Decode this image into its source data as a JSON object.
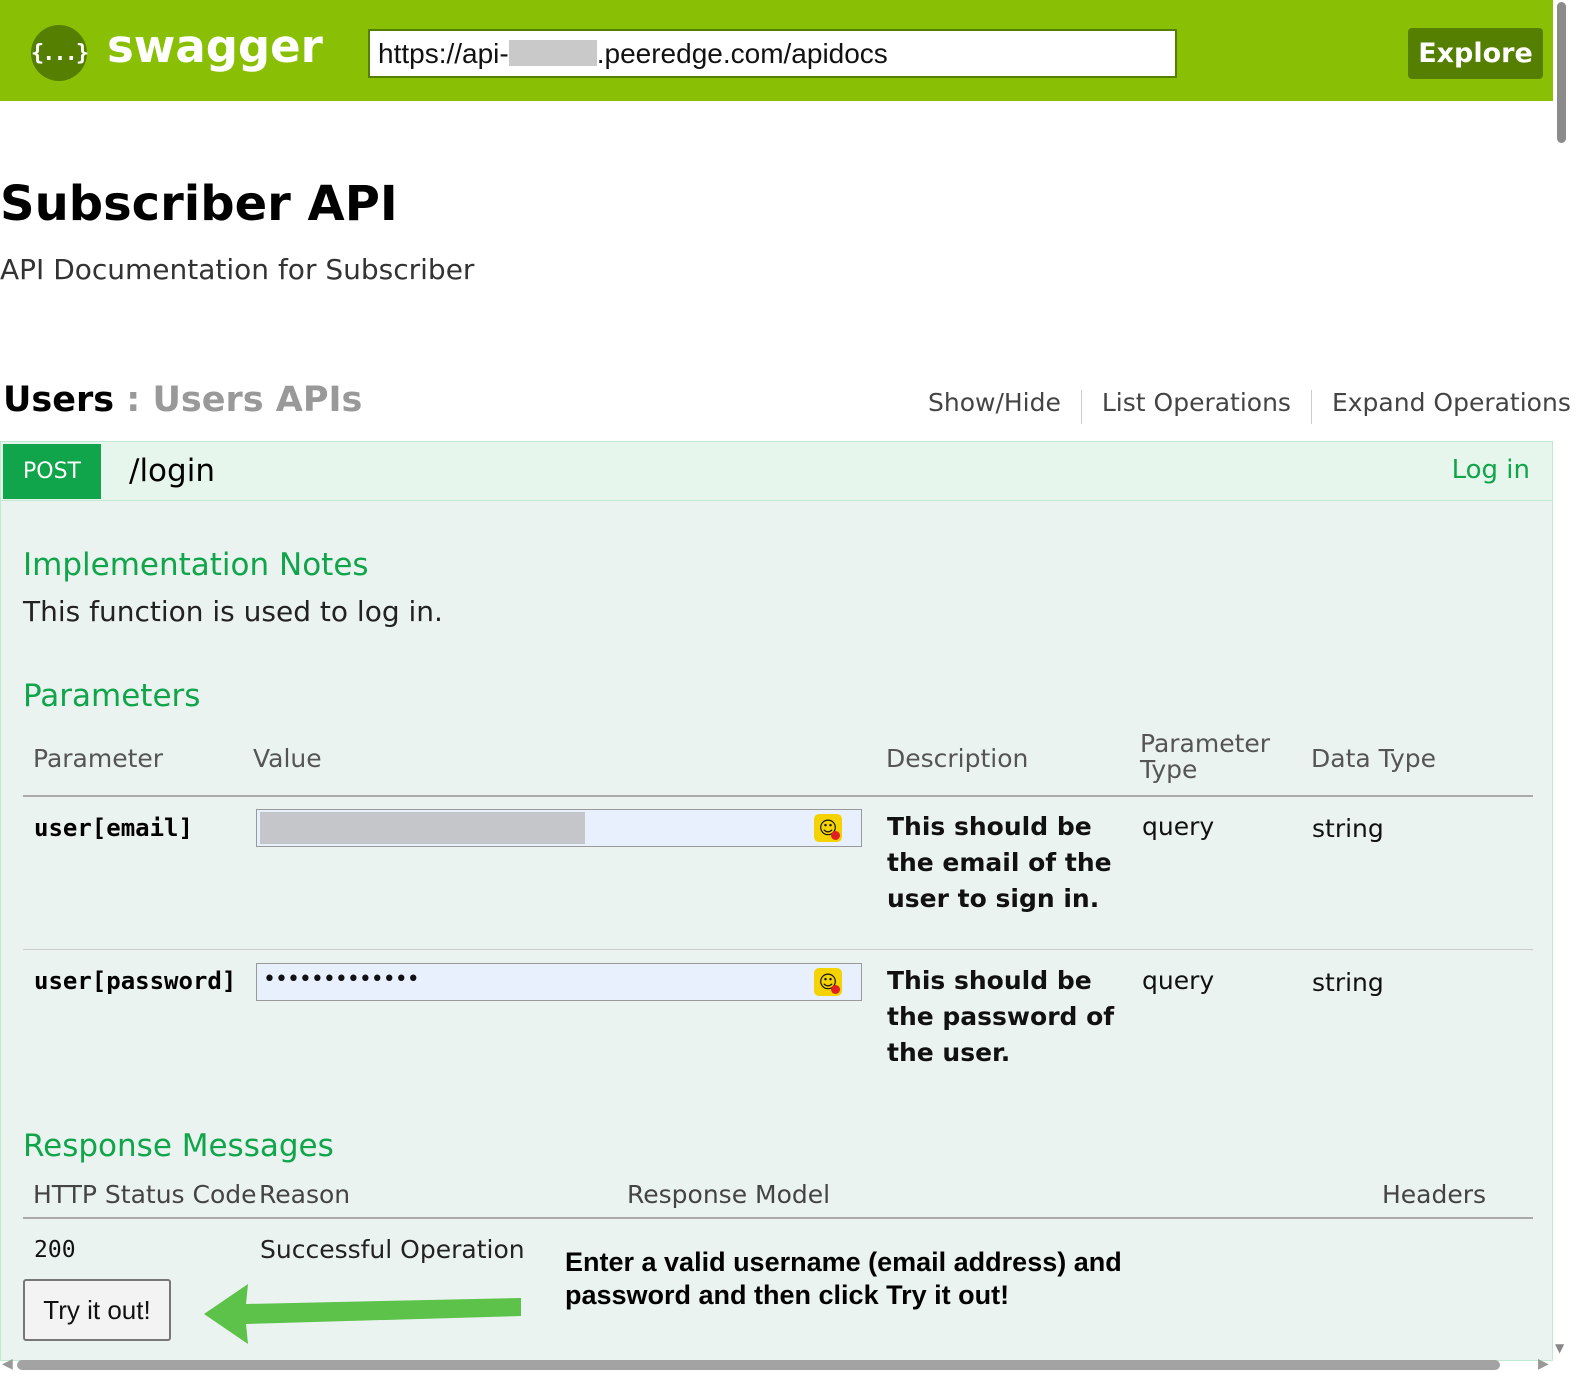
{
  "header": {
    "logo_glyph": "{...}",
    "logo_text": "swagger",
    "url_prefix": "https://api-",
    "url_suffix": ".peeredge.com/apidocs",
    "explore_label": "Explore"
  },
  "info": {
    "title": "Subscriber API",
    "description": "API Documentation for Subscriber"
  },
  "resource": {
    "name": "Users",
    "separator": " : ",
    "description": "Users APIs",
    "links": [
      "Show/Hide",
      "List Operations",
      "Expand Operations"
    ]
  },
  "operation": {
    "method": "POST",
    "path": "/login",
    "summary": "Log in",
    "implementation_title": "Implementation Notes",
    "implementation_text": "This function is used to log in.",
    "parameters_title": "Parameters",
    "param_headers": {
      "parameter": "Parameter",
      "value": "Value",
      "description": "Description",
      "parameter_type": "Parameter Type",
      "data_type": "Data Type"
    },
    "params": [
      {
        "name": "user[email]",
        "value_display": "",
        "description": "This should be the email of the user to sign in.",
        "param_type": "query",
        "data_type": "string"
      },
      {
        "name": "user[password]",
        "value_display": "•••••••••••••",
        "description": "This should be the password of the user.",
        "param_type": "query",
        "data_type": "string"
      }
    ],
    "responses_title": "Response Messages",
    "response_headers": {
      "status": "HTTP Status Code",
      "reason": "Reason",
      "model": "Response Model",
      "headers": "Headers"
    },
    "responses": [
      {
        "code": "200",
        "reason": "Successful Operation"
      }
    ],
    "try_label": "Try it out!"
  },
  "annotation": {
    "text": "Enter a valid username (email address) and password and then click Try it out!",
    "arrow_color": "#5cc24a"
  },
  "colors": {
    "header_bg": "#89bf04",
    "header_dark": "#547f00",
    "post_green": "#10a54a",
    "op_bg": "#ebf3f0"
  }
}
